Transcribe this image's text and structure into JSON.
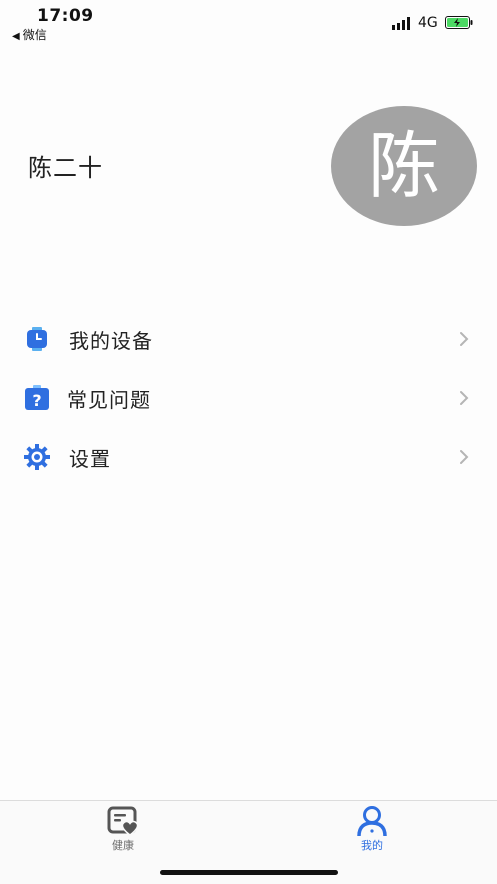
{
  "status_bar": {
    "time": "17:09",
    "back_app": "微信",
    "network": "4G"
  },
  "profile": {
    "name": "陈二十",
    "avatar_char": "陈"
  },
  "menu": {
    "items": [
      {
        "label": "我的设备",
        "icon": "watch-icon"
      },
      {
        "label": "常见问题",
        "icon": "question-icon"
      },
      {
        "label": "设置",
        "icon": "gear-icon"
      }
    ]
  },
  "tab_bar": {
    "tabs": [
      {
        "label": "健康",
        "icon": "health-heart-icon",
        "active": false
      },
      {
        "label": "我的",
        "icon": "user-icon",
        "active": true
      }
    ],
    "active_color": "#2f6fe0",
    "inactive_color": "#6b6b6b"
  }
}
